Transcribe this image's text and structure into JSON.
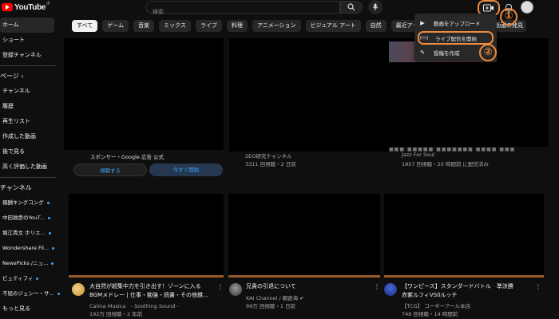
{
  "header": {
    "logo_text": "YouTube",
    "logo_region": "JP",
    "search_placeholder": "検索",
    "accent": "#ff0000",
    "annotation_color": "#f08a3c"
  },
  "sidebar": {
    "items": [
      {
        "label": "ホーム",
        "active": true
      },
      {
        "label": "ショート"
      },
      {
        "label": "登録チャンネル"
      }
    ],
    "you_header": "ページ",
    "you_items": [
      "チャンネル",
      "履歴",
      "再生リスト",
      "作成した動画",
      "後で見る",
      "高く評価した動画"
    ],
    "subs_header": "チャンネル",
    "subs": [
      {
        "label": "報酬キングコング"
      },
      {
        "label": "中田敦彦のYouT..."
      },
      {
        "label": "堀江貴文 ホリエ..."
      },
      {
        "label": "Wondershare Fil..."
      },
      {
        "label": "NewsPicks /ニュ..."
      },
      {
        "label": "ビュティフィ"
      },
      {
        "label": "不屈のジェシー・サ..."
      }
    ],
    "more": "もっと見る"
  },
  "chips": [
    "すべて",
    "ゲーム",
    "音楽",
    "ミックス",
    "ライブ",
    "料理",
    "アニメーション",
    "ビジュアル アート",
    "自然",
    "最近アップロードされ"
  ],
  "chip_right": "動画の発見",
  "row1": [
    {
      "meta1": "スポンサー・Google 広告 公式",
      "btn1": "視聴する",
      "btn2": "今すぐ開始"
    },
    {
      "meta1": "SEO研究チャンネル",
      "meta2": "3311 回視聴・2 日前"
    },
    {
      "meta1": "Jazz For Soul",
      "meta2": "1857 回視聴・20 時間前 に配信済み"
    }
  ],
  "row2": [
    {
      "title1": "大自然が超集中力を引き出す！ゾーンに入る",
      "title2": "BGMメドレー | 仕事・勉強・読書・その他雑...",
      "channel": "Calma Musica　- Soothing Sound -",
      "stats": "192万 回視聴・2 年前"
    },
    {
      "title1": "兄貴の引退について",
      "channel": "KAI Channel / 朝倉海",
      "stats": "99万 回視聴・1 日前"
    },
    {
      "title1": "【ワンピース】スタンダードバトル　準決勝",
      "title2": "赤紫ルフィVS0ルッチ",
      "channel": "【TCG】 コーギーアール本店",
      "stats": "748 回視聴・14 時間前"
    }
  ],
  "dropdown": {
    "items": [
      {
        "icon": "▶",
        "label": "動画をアップロード"
      },
      {
        "icon": "((•))",
        "label": "ライブ配信を開始"
      },
      {
        "icon": "✎",
        "label": "投稿を作成"
      }
    ]
  },
  "annotations": [
    "①",
    "②"
  ]
}
